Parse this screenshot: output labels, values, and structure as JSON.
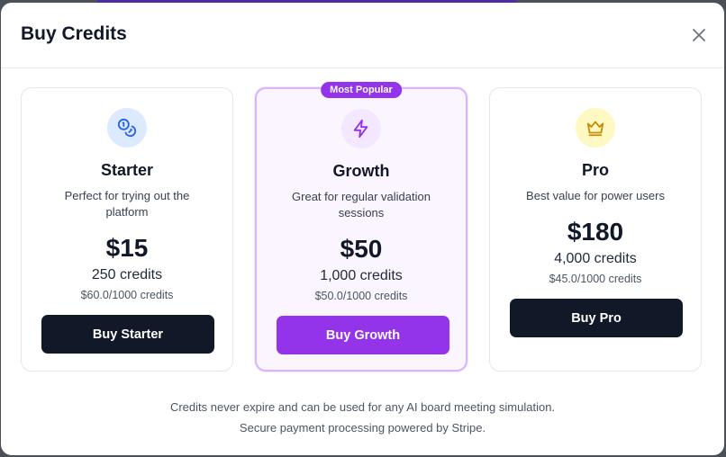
{
  "modal": {
    "title": "Buy Credits",
    "close_icon": "close-icon"
  },
  "plans": [
    {
      "name": "Starter",
      "description": "Perfect for trying out the platform",
      "price": "$15",
      "credits": "250 credits",
      "per_thousand": "$60.0/1000 credits",
      "button_label": "Buy Starter",
      "icon": "coins-icon",
      "icon_color": "#2563eb",
      "icon_bg": "#dbeafe"
    },
    {
      "name": "Growth",
      "badge": "Most Popular",
      "description": "Great for regular validation sessions",
      "price": "$50",
      "credits": "1,000 credits",
      "per_thousand": "$50.0/1000 credits",
      "button_label": "Buy Growth",
      "icon": "lightning-icon",
      "icon_color": "#9333ea",
      "icon_bg": "#f3e8ff"
    },
    {
      "name": "Pro",
      "description": "Best value for power users",
      "price": "$180",
      "credits": "4,000 credits",
      "per_thousand": "$45.0/1000 credits",
      "button_label": "Buy Pro",
      "icon": "crown-icon",
      "icon_color": "#ca8a04",
      "icon_bg": "#fef9c3"
    }
  ],
  "footer": {
    "line1": "Credits never expire and can be used for any AI board meeting simulation.",
    "line2": "Secure payment processing powered by Stripe."
  },
  "colors": {
    "accent": "#9333ea",
    "dark_button": "#111827"
  }
}
